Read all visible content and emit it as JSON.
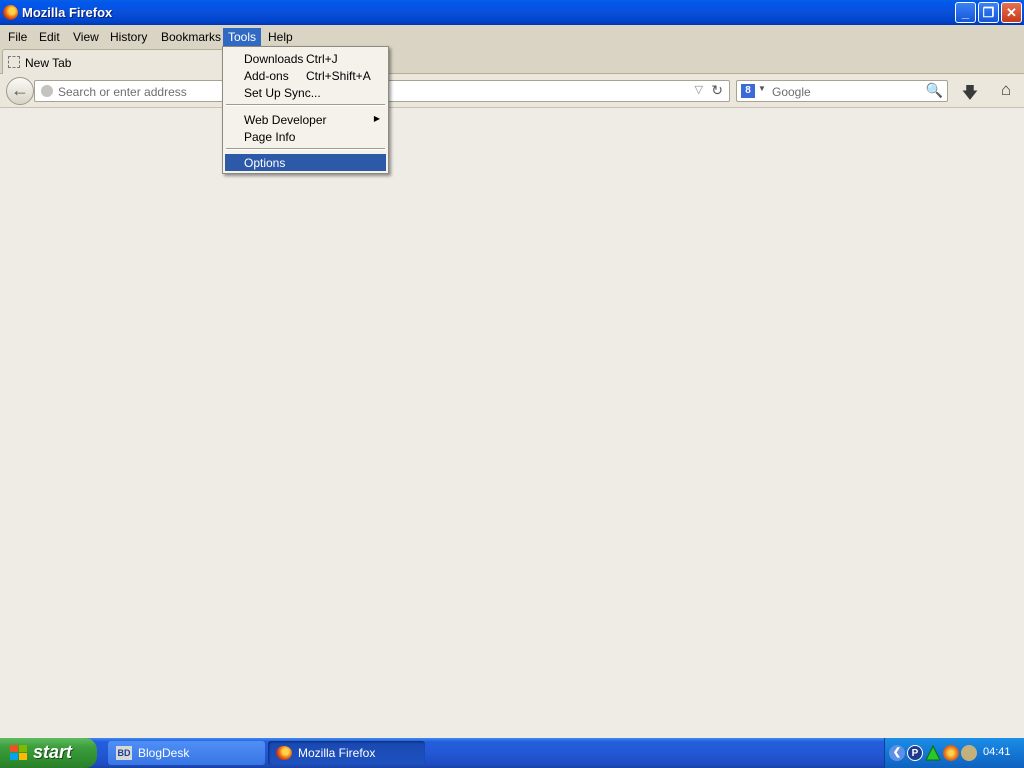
{
  "window": {
    "title": "Mozilla Firefox",
    "controls": {
      "minimize": "_",
      "restore": "❐",
      "close": "✕"
    }
  },
  "menubar": {
    "items": [
      {
        "label": "File"
      },
      {
        "label": "Edit"
      },
      {
        "label": "View"
      },
      {
        "label": "History"
      },
      {
        "label": "Bookmarks"
      },
      {
        "label": "Tools"
      },
      {
        "label": "Help"
      }
    ]
  },
  "tabs": [
    {
      "label": "New Tab"
    }
  ],
  "navbar": {
    "url_placeholder": "Search or enter address",
    "search_engine": "Google",
    "search_engine_icon": "8"
  },
  "tools_menu": {
    "items": [
      {
        "label": "Downloads",
        "shortcut": "Ctrl+J"
      },
      {
        "label": "Add-ons",
        "shortcut": "Ctrl+Shift+A"
      },
      {
        "label": "Set Up Sync..."
      },
      {
        "label": "Web Developer",
        "has_submenu": true
      },
      {
        "label": "Page Info"
      },
      {
        "label": "Options",
        "highlighted": true
      }
    ]
  },
  "taskbar": {
    "start_label": "start",
    "buttons": [
      {
        "label": "BlogDesk",
        "icon_text": "BD"
      },
      {
        "label": "Mozilla Firefox"
      }
    ],
    "tray_icons": [
      "P"
    ],
    "clock": "04:41"
  },
  "colors": {
    "titlebar": "#0a4fd8",
    "menu_highlight": "#2d5aa8",
    "content_bg": "#efebe5",
    "start_green": "#3c9e3c"
  }
}
